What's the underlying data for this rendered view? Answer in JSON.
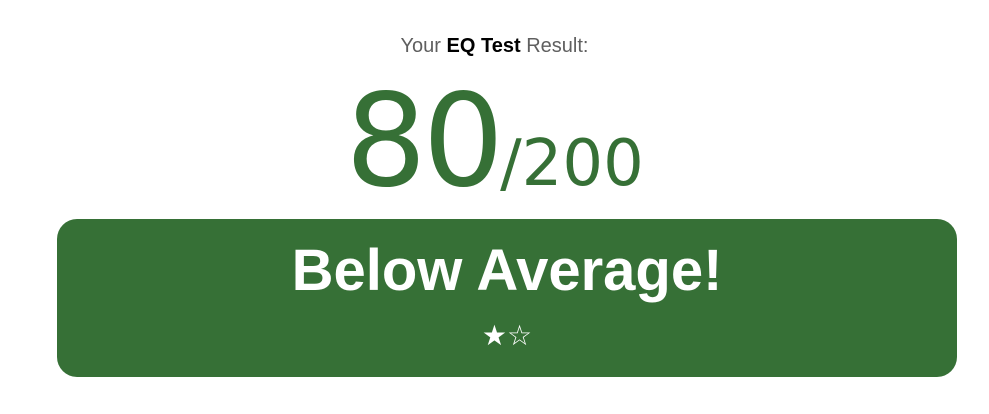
{
  "header": {
    "prefix": "Your",
    "test_name": "EQ Test",
    "suffix": "Result:"
  },
  "score": {
    "value": "80",
    "total": "/200"
  },
  "result": {
    "label": "Below Average!",
    "rating": {
      "filled": 1,
      "max": 2,
      "filled_glyph": "★",
      "empty_glyph": "☆"
    }
  },
  "colors": {
    "accent": "#367036",
    "text_muted": "#5f5f5f",
    "text_strong": "#000000",
    "card_text": "#ffffff"
  }
}
